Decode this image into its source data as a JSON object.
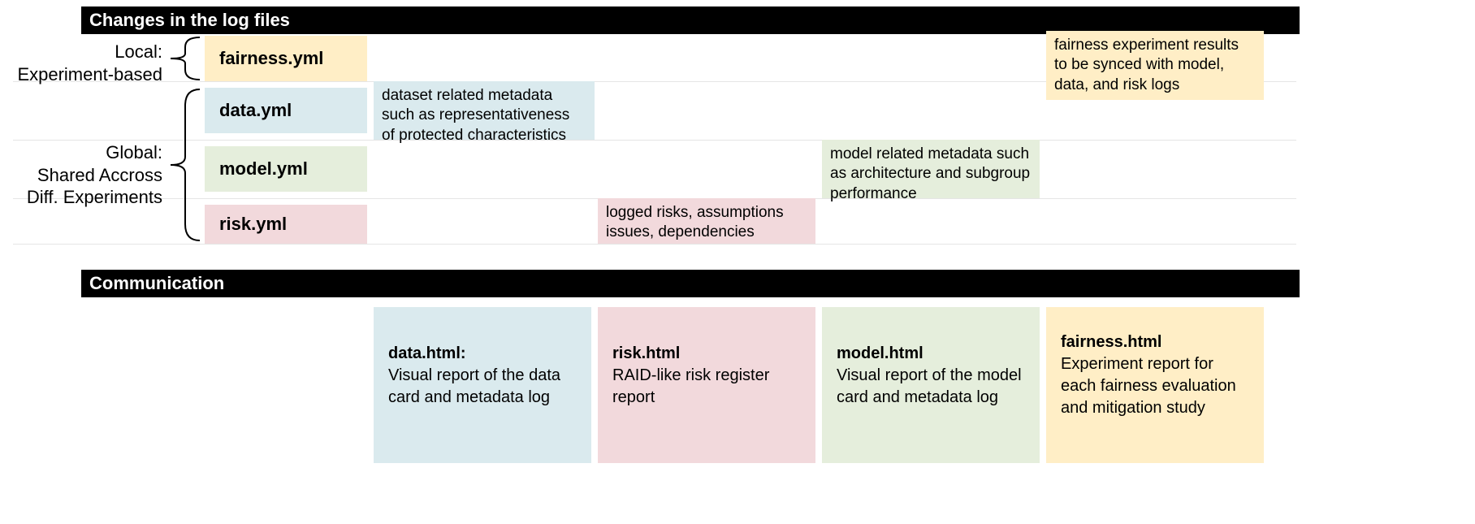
{
  "section1_title": "Changes in the log files",
  "section2_title": "Communication",
  "side_local": "Local:\nExperiment-based",
  "side_global": "Global:\nShared Accross\nDiff. Experiments",
  "rows": {
    "fairness": {
      "file": "fairness.yml",
      "desc": "fairness experiment results to be synced with model, data, and risk logs"
    },
    "data": {
      "file": "data.yml",
      "desc": "dataset related metadata such as representativeness of protected characteristics"
    },
    "model": {
      "file": "model.yml",
      "desc": "model related metadata such as architecture and subgroup performance"
    },
    "risk": {
      "file": "risk.yml",
      "desc": "logged risks, assumptions issues, dependencies"
    }
  },
  "comm": {
    "data": {
      "title": "data.html:",
      "desc": "Visual report of the data card and metadata log"
    },
    "risk": {
      "title": "risk.html",
      "desc": "RAID-like risk register report"
    },
    "model": {
      "title": "model.html",
      "desc": "Visual report of the model card and metadata log"
    },
    "fairness": {
      "title": "fairness.html",
      "desc": "Experiment report for each fairness evaluation and mitigation study"
    }
  }
}
